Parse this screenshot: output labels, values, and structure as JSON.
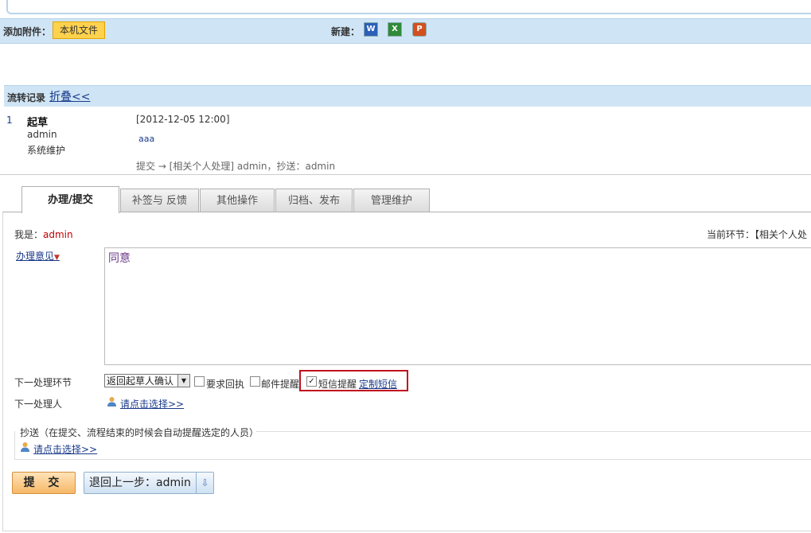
{
  "attachments": {
    "label": "添加附件：",
    "local_file_button": "本机文件",
    "new_label": "新建：",
    "new_icons": [
      "word-icon",
      "excel-icon",
      "powerpoint-icon"
    ]
  },
  "flow_record": {
    "title": "流转记录",
    "fold_link": "折叠<<",
    "entries": [
      {
        "index": "1",
        "step": "起草",
        "user": "admin",
        "dept": "系统维护",
        "time": "[2012-12-05 12:00]",
        "comment": "aaa",
        "route": "提交 → [相关个人处理] admin，抄送：admin"
      }
    ]
  },
  "tabs": [
    {
      "label": "办理/提交",
      "active": true
    },
    {
      "label": "补签与 反馈",
      "active": false
    },
    {
      "label": "其他操作",
      "active": false
    },
    {
      "label": "归档、发布",
      "active": false
    },
    {
      "label": "管理维护",
      "active": false
    }
  ],
  "form": {
    "iam_label": "我是：",
    "iam_name": "admin",
    "current_step": "当前环节：【相关个人处",
    "opinion_link": "办理意见",
    "opinion_value": "同意",
    "next_step_label": "下一处理环节",
    "next_step_select": "返回起草人确认",
    "require_receipt": "要求回执",
    "email_remind": "邮件提醒",
    "sms_remind": "短信提醒",
    "sms_remind_checked": true,
    "custom_sms_link": "定制短信",
    "next_person_label": "下一处理人",
    "next_person_pick": "请点击选择>>",
    "cc_title": "抄送（在提交、流程结束的时候会自动提醒选定的人员）",
    "cc_pick": "请点击选择>>"
  },
  "actions": {
    "submit": "提 交",
    "back": "退回上一步：admin"
  },
  "colors": {
    "bar_bg": "#cfe5f5",
    "highlight_border": "#c0101e",
    "link": "#1a3a8a"
  }
}
